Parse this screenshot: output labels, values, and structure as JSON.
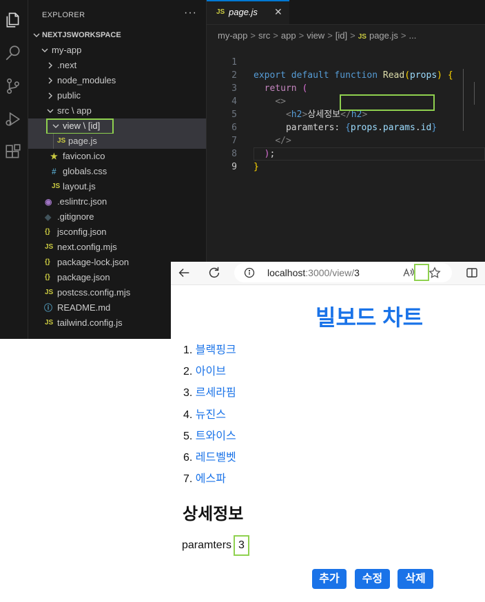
{
  "explorer": {
    "title": "EXPLORER",
    "more": "···",
    "workspace": "NEXTJSWORKSPACE",
    "items": [
      {
        "label": "my-app"
      },
      {
        "label": ".next"
      },
      {
        "label": "node_modules"
      },
      {
        "label": "public"
      },
      {
        "label": "src \\ app"
      },
      {
        "label": "view \\ [id]"
      },
      {
        "label": "page.js",
        "icon": "JS"
      },
      {
        "label": "favicon.ico",
        "icon": "★"
      },
      {
        "label": "globals.css",
        "icon": "#"
      },
      {
        "label": "layout.js",
        "icon": "JS"
      },
      {
        "label": ".eslintrc.json",
        "icon": "◉"
      },
      {
        "label": ".gitignore",
        "icon": "◆"
      },
      {
        "label": "jsconfig.json",
        "icon": "{}"
      },
      {
        "label": "next.config.mjs",
        "icon": "JS"
      },
      {
        "label": "package-lock.json",
        "icon": "{}"
      },
      {
        "label": "package.json",
        "icon": "{}"
      },
      {
        "label": "postcss.config.mjs",
        "icon": "JS"
      },
      {
        "label": "README.md",
        "icon": "ⓘ"
      },
      {
        "label": "tailwind.config.js",
        "icon": "JS"
      }
    ]
  },
  "editor": {
    "tab": {
      "icon": "JS",
      "name": "page.js",
      "close": "✕"
    },
    "breadcrumb": [
      "my-app",
      "src",
      "app",
      "view",
      "[id]",
      "page.js",
      "..."
    ],
    "breadcrumb_sep": ">",
    "line_numbers": [
      "1",
      "2",
      "3",
      "4",
      "5",
      "6",
      "7",
      "8",
      "9"
    ],
    "code": {
      "l1": {
        "a": "export",
        "b": "default",
        "c": "function",
        "d": "Read",
        "e": "(",
        "f": "props",
        "g": ")",
        "h": "{"
      },
      "l2": {
        "a": "return",
        "b": "("
      },
      "l3": {
        "a": "<>"
      },
      "l4": {
        "a": "<",
        "b": "h2",
        "c": ">",
        "d": "상세정보",
        "e": "</",
        "f": "h2",
        "g": ">"
      },
      "l5": {
        "a": "paramters:",
        "b": "{",
        "c": "props",
        "d": ".",
        "e": "params",
        "f": ".",
        "g": "id",
        "h": "}"
      },
      "l6": {
        "a": "</>"
      },
      "l7": {
        "a": ")",
        "b": ";"
      },
      "l8": {
        "a": "}"
      }
    }
  },
  "browser": {
    "url_host": "localhost",
    "url_path": ":3000/view/",
    "url_id": "3",
    "page_title": "빌보드 차트",
    "list": [
      {
        "num": "1.",
        "name": "블랙핑크"
      },
      {
        "num": "2.",
        "name": "아이브"
      },
      {
        "num": "3.",
        "name": "르세라핌"
      },
      {
        "num": "4.",
        "name": "뉴진스"
      },
      {
        "num": "5.",
        "name": "트와이스"
      },
      {
        "num": "6.",
        "name": "레드벨벳"
      },
      {
        "num": "7.",
        "name": "에스파"
      }
    ],
    "detail_heading": "상세정보",
    "detail_label": "paramters",
    "detail_value": "3",
    "buttons": {
      "add": "추가",
      "edit": "수정",
      "delete": "삭제"
    }
  },
  "colors": {
    "highlight": "#8fd14f",
    "accent": "#1a73e8",
    "editor_bg": "#1f1f1f",
    "sidebar_bg": "#181818"
  }
}
